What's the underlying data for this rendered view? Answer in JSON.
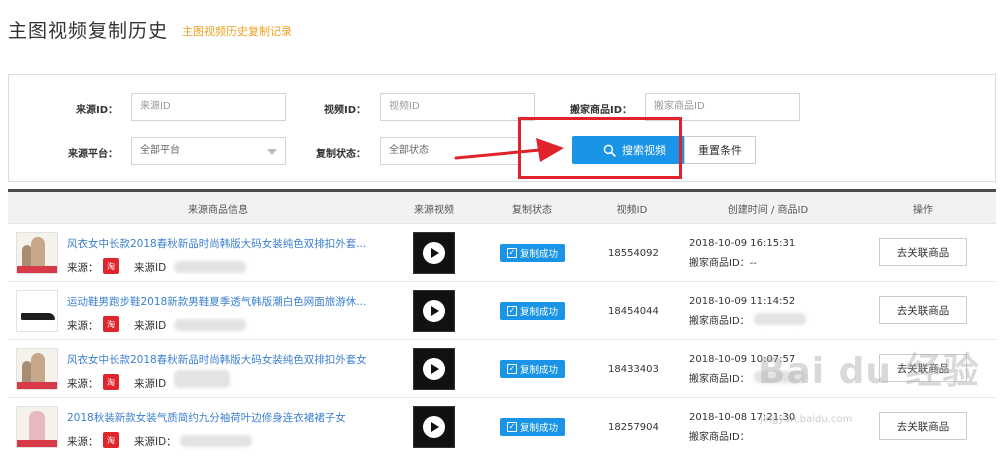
{
  "header": {
    "title": "主图视频复制历史",
    "subtitle": "主图视频历史复制记录"
  },
  "filters": {
    "source_id_label": "来源ID：",
    "source_id_placeholder": "来源ID",
    "video_id_label": "视频ID：",
    "video_id_placeholder": "视频ID",
    "move_product_id_label": "搬家商品ID：",
    "move_product_id_placeholder": "搬家商品ID",
    "platform_label": "来源平台：",
    "platform_value": "全部平台",
    "status_label": "复制状态：",
    "status_value": "全部状态",
    "search_label": "搜索视频",
    "reset_label": "重置条件"
  },
  "table": {
    "columns": [
      "来源商品信息",
      "来源视频",
      "复制状态",
      "视频ID",
      "创建时间 / 商品ID",
      "操作"
    ],
    "rows": [
      {
        "title": "风衣女中长款2018春秋新品时尚韩版大码女装纯色双排扣外套...",
        "source_label": "来源：",
        "source_id_label": "来源ID",
        "status": "复制成功",
        "video_id": "18554092",
        "created": "2018-10-09 16:15:31",
        "move_id": "搬家商品ID：--",
        "action": "去关联商品"
      },
      {
        "title": "运动鞋男跑步鞋2018新款男鞋夏季透气韩版潮白色网面旅游休...",
        "source_label": "来源：",
        "source_id_label": "来源ID",
        "status": "复制成功",
        "video_id": "18454044",
        "created": "2018-10-09 11:14:52",
        "move_id": "搬家商品ID：",
        "action": "去关联商品"
      },
      {
        "title": "风衣女中长款2018春秋新品时尚韩版大码女装纯色双排扣外套女",
        "source_label": "来源：",
        "source_id_label": "来源ID",
        "status": "复制成功",
        "video_id": "18433403",
        "created": "2018-10-09 10:07:57",
        "move_id": "搬家商品ID：",
        "action": "去关联商品"
      },
      {
        "title": "2018秋装新款女装气质简约九分袖荷叶边修身连衣裙裙子女",
        "source_label": "来源：",
        "source_id_label": "来源ID：",
        "status": "复制成功",
        "video_id": "18257904",
        "created": "2018-10-08 17:21:30",
        "move_id": "搬家商品ID：",
        "action": "去关联商品"
      }
    ]
  },
  "source_logo_text": "淘",
  "watermark": {
    "brand": "Bai du 经验",
    "url": "jingyan.baidu.com"
  },
  "colors": {
    "accent": "#1a94e6",
    "highlight": "#e0222a",
    "link": "#3a7fcf",
    "subtitle": "#f0a020"
  }
}
